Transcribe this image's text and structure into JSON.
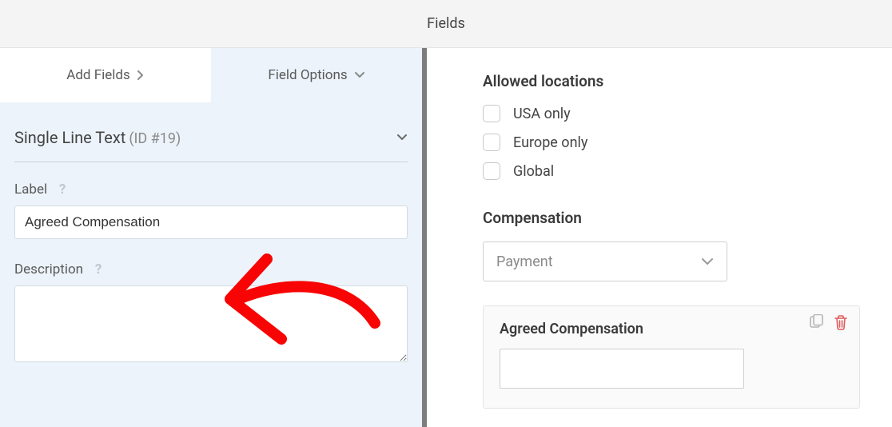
{
  "header": {
    "title": "Fields"
  },
  "tabs": {
    "add_fields": "Add Fields",
    "field_options": "Field Options"
  },
  "field_type": {
    "name": "Single Line Text",
    "id_label": "(ID #19)"
  },
  "form": {
    "label_title": "Label",
    "label_value": "Agreed Compensation",
    "description_title": "Description",
    "description_value": ""
  },
  "preview": {
    "allowed_locations_title": "Allowed locations",
    "locations": [
      "USA only",
      "Europe only",
      "Global"
    ],
    "compensation_title": "Compensation",
    "compensation_placeholder": "Payment",
    "card_title": "Agreed Compensation"
  }
}
